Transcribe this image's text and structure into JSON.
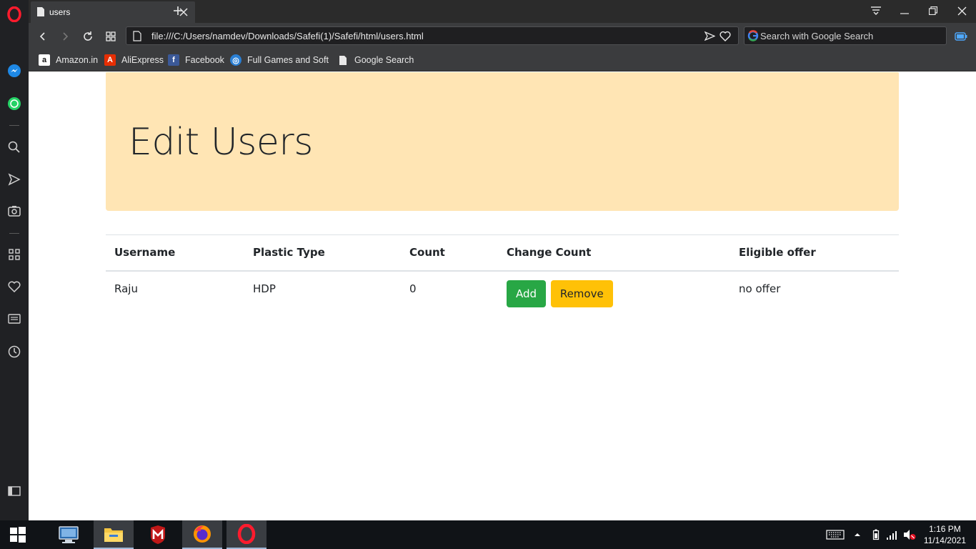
{
  "browser": {
    "tab_title": "users",
    "url": "file:///C:/Users/namdev/Downloads/Safefi(1)/Safefi/html/users.html",
    "search_placeholder": "Search with Google Search"
  },
  "bookmarks": [
    {
      "label": "Amazon.in",
      "icon": "amazon-icon"
    },
    {
      "label": "AliExpress",
      "icon": "aliexpress-icon"
    },
    {
      "label": "Facebook",
      "icon": "facebook-icon"
    },
    {
      "label": "Full Games and Softw",
      "icon": "globe-icon"
    },
    {
      "label": "Google Search",
      "icon": "document-icon"
    }
  ],
  "page": {
    "heading": "Edit Users",
    "table": {
      "headers": [
        "Username",
        "Plastic Type",
        "Count",
        "Change Count",
        "Eligible offer"
      ],
      "rows": [
        {
          "username": "Raju",
          "plastic_type": "HDP",
          "count": "0",
          "add_label": "Add",
          "remove_label": "Remove",
          "offer": "no offer"
        }
      ]
    }
  },
  "colors": {
    "jumbotron": "#ffe5b4",
    "add_button": "#28a745",
    "remove_button": "#ffc107",
    "opera_red": "#ff1b2d"
  },
  "taskbar": {
    "time": "1:16 PM",
    "date": "11/14/2021",
    "apps": [
      "remote-desktop-icon",
      "file-explorer-icon",
      "mcafee-icon",
      "firefox-icon",
      "opera-icon"
    ]
  }
}
